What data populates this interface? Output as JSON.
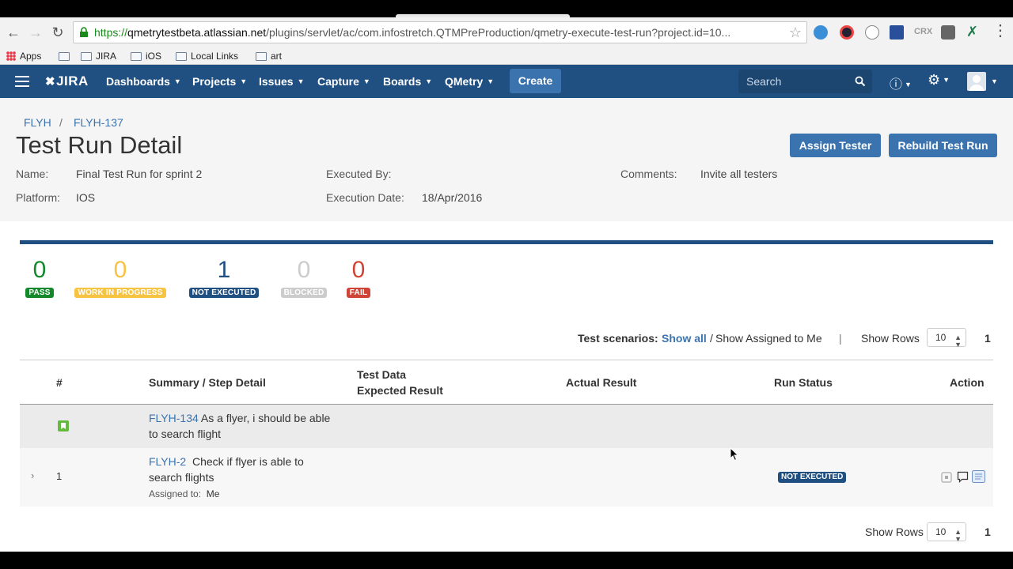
{
  "browser": {
    "url_scheme": "https://",
    "url_host": "qmetrytestbeta.atlassian.net",
    "url_path": "/plugins/servlet/ac/com.infostretch.QTMPreProduction/qmetry-execute-test-run?project.id=10...",
    "bookmarks": [
      "Apps",
      "JIRA",
      "iOS",
      "Local Links",
      "art"
    ],
    "extension_crx": "CRX"
  },
  "header": {
    "logo": "JIRA",
    "nav": [
      "Dashboards",
      "Projects",
      "Issues",
      "Capture",
      "Boards",
      "QMetry"
    ],
    "create_label": "Create",
    "search_placeholder": "Search",
    "brand_color": "#205081"
  },
  "breadcrumb": [
    "FLYH",
    "FLYH-137"
  ],
  "page_title": "Test Run Detail",
  "buttons": {
    "assign": "Assign Tester",
    "rebuild": "Rebuild Test Run"
  },
  "meta": {
    "name_label": "Name:",
    "name_value": "Final Test Run for sprint 2",
    "platform_label": "Platform:",
    "platform_value": "IOS",
    "executed_by_label": "Executed By:",
    "execution_date_label": "Execution Date:",
    "execution_date_value": "18/Apr/2016",
    "comments_label": "Comments:",
    "comments_value": "Invite all testers"
  },
  "stats": [
    {
      "count": "0",
      "label": "PASS",
      "color": "#14892c"
    },
    {
      "count": "0",
      "label": "WORK IN PROGRESS",
      "color": "#f6c342"
    },
    {
      "count": "1",
      "label": "NOT EXECUTED",
      "color": "#205081"
    },
    {
      "count": "0",
      "label": "BLOCKED",
      "color": "#cccccc"
    },
    {
      "count": "0",
      "label": "FAIL",
      "color": "#d04437"
    }
  ],
  "toolbar": {
    "scenarios_label": "Test scenarios:",
    "show_all": "Show all",
    "slash": "/",
    "show_assigned": "Show Assigned to Me",
    "pipe": "|",
    "show_rows_label": "Show Rows",
    "rows_value": "10",
    "page": "1"
  },
  "table": {
    "headers": {
      "num": "#",
      "summary": "Summary / Step Detail",
      "test_data": "Test Data",
      "expected": "Expected Result",
      "actual": "Actual Result",
      "status": "Run Status",
      "action": "Action"
    },
    "group": {
      "key": "FLYH-134",
      "summary_line1": "As a flyer, i should be able",
      "summary_line2": "to search flight"
    },
    "step": {
      "num": "1",
      "key": "FLYH-2",
      "summary_line1": "Check if flyer is able to",
      "summary_line2": "search flights",
      "assigned_label": "Assigned to:",
      "assigned_value": "Me",
      "status": "NOT EXECUTED"
    }
  },
  "footer": {
    "show_rows_label": "Show Rows",
    "rows_value": "10",
    "page": "1"
  }
}
